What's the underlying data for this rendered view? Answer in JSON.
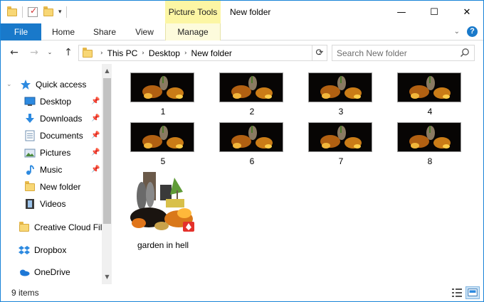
{
  "title_bar": {
    "contextual_tab": "Picture Tools",
    "window_title": "New folder",
    "controls": {
      "minimize": "—",
      "maximize": "☐",
      "close": "✕"
    }
  },
  "ribbon": {
    "tabs": [
      "File",
      "Home",
      "Share",
      "View",
      "Manage"
    ],
    "help": "?"
  },
  "address_bar": {
    "breadcrumbs": [
      "This PC",
      "Desktop",
      "New folder"
    ],
    "search_placeholder": "Search New folder"
  },
  "navigation_pane": {
    "quick_access": "Quick access",
    "items": [
      {
        "label": "Desktop",
        "icon": "desktop-icon",
        "pinned": true
      },
      {
        "label": "Downloads",
        "icon": "downloads-icon",
        "pinned": true
      },
      {
        "label": "Documents",
        "icon": "documents-icon",
        "pinned": true
      },
      {
        "label": "Pictures",
        "icon": "pictures-icon",
        "pinned": true
      },
      {
        "label": "Music",
        "icon": "music-icon",
        "pinned": true
      },
      {
        "label": "New folder",
        "icon": "folder-icon",
        "pinned": false
      },
      {
        "label": "Videos",
        "icon": "videos-icon",
        "pinned": false
      }
    ],
    "roots": [
      {
        "label": "Creative Cloud Fil",
        "icon": "creative-cloud-icon"
      },
      {
        "label": "Dropbox",
        "icon": "dropbox-icon"
      },
      {
        "label": "OneDrive",
        "icon": "onedrive-icon"
      }
    ]
  },
  "files": [
    {
      "name": "1",
      "type": "image"
    },
    {
      "name": "2",
      "type": "image"
    },
    {
      "name": "3",
      "type": "image"
    },
    {
      "name": "4",
      "type": "image"
    },
    {
      "name": "5",
      "type": "image"
    },
    {
      "name": "6",
      "type": "image"
    },
    {
      "name": "7",
      "type": "image"
    },
    {
      "name": "8",
      "type": "image"
    },
    {
      "name": "garden in hell",
      "type": "sketchup-model"
    }
  ],
  "status_bar": {
    "item_count": "9 items"
  },
  "colors": {
    "accent": "#1979ca",
    "picture_tools": "#fcf6a4",
    "window_border": "#1883d7"
  }
}
